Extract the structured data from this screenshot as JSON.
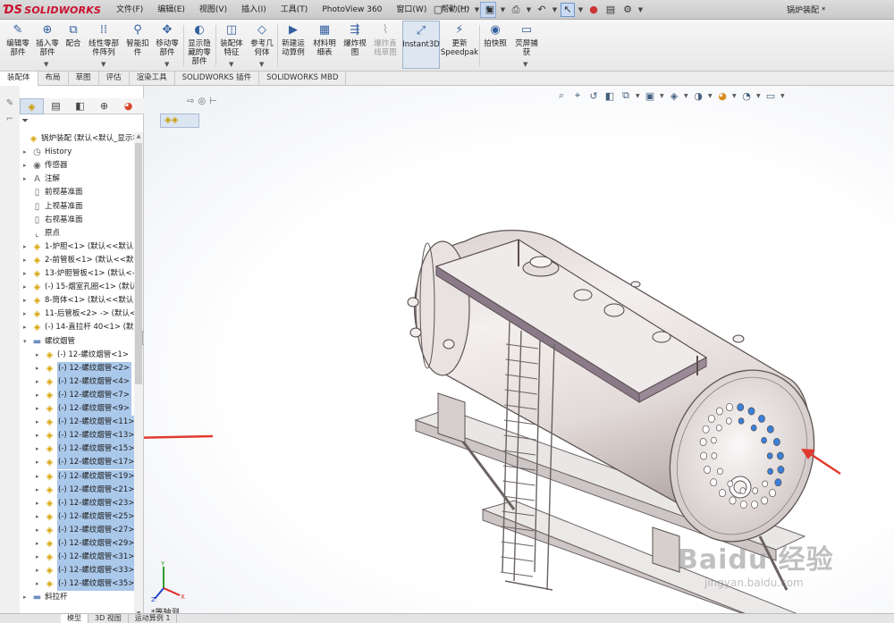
{
  "app": {
    "logo_text": "SOLIDWORKS",
    "doc_title": "锅炉装配 *"
  },
  "menu": [
    "文件(F)",
    "编辑(E)",
    "视图(V)",
    "插入(I)",
    "工具(T)",
    "PhotoView 360",
    "窗口(W)",
    "帮助(H)"
  ],
  "ribbon": {
    "buttons": [
      {
        "label": "编辑零\n部件",
        "icon": "edit-component-icon"
      },
      {
        "label": "插入零\n部件",
        "icon": "insert-component-icon"
      },
      {
        "label": "配合",
        "icon": "mate-icon"
      },
      {
        "label": "线性零部\n件阵列",
        "icon": "linear-pattern-icon"
      },
      {
        "label": "智能扣\n件",
        "icon": "smart-fastener-icon"
      },
      {
        "label": "移动零\n部件",
        "icon": "move-component-icon"
      },
      {
        "label": "显示隐\n藏的零\n部件",
        "icon": "show-hidden-icon"
      },
      {
        "label": "装配体\n特征",
        "icon": "assembly-feature-icon"
      },
      {
        "label": "参考几\n何体",
        "icon": "reference-geometry-icon"
      },
      {
        "label": "新建运\n动算例",
        "icon": "motion-study-icon"
      },
      {
        "label": "材料明\n细表",
        "icon": "bom-icon"
      },
      {
        "label": "爆炸视\n图",
        "icon": "exploded-view-icon"
      },
      {
        "label": "爆炸直\n线草图",
        "icon": "explode-line-sketch-icon",
        "disabled": true
      },
      {
        "label": "Instant3D",
        "icon": "instant3d-icon",
        "selected": true
      },
      {
        "label": "更新\nSpeedpak",
        "icon": "speedpak-icon"
      },
      {
        "label": "拍快照",
        "icon": "snapshot-icon"
      },
      {
        "label": "荧屏捕\n获",
        "icon": "screen-capture-icon"
      }
    ]
  },
  "cm_tabs": [
    "装配体",
    "布局",
    "草图",
    "评估",
    "渲染工具",
    "SOLIDWORKS 插件",
    "SOLIDWORKS MBD"
  ],
  "tree": {
    "root": "锅炉装配 (默认<默认_显示状",
    "items": [
      {
        "label": "History",
        "icon": "history-icon"
      },
      {
        "label": "传感器",
        "icon": "sensor-icon"
      },
      {
        "label": "注解",
        "icon": "annotation-icon"
      },
      {
        "label": "前视基准面",
        "icon": "plane-icon"
      },
      {
        "label": "上视基准面",
        "icon": "plane-icon"
      },
      {
        "label": "右视基准面",
        "icon": "plane-icon"
      },
      {
        "label": "原点",
        "icon": "origin-icon"
      },
      {
        "label": "1-炉胆<1> (默认<<默认",
        "icon": "part-icon"
      },
      {
        "label": "2-前管板<1> (默认<<默认",
        "icon": "part-icon"
      },
      {
        "label": "13-炉胆管板<1> (默认<-",
        "icon": "part-icon"
      },
      {
        "label": "(-) 15-烟室孔圈<1> (默认",
        "icon": "part-icon"
      },
      {
        "label": "8-筒体<1> (默认<<默认",
        "icon": "part-icon"
      },
      {
        "label": "11-后管板<2> -> (默认<",
        "icon": "part-icon"
      },
      {
        "label": "(-) 14-直拉杆 40<1> (默",
        "icon": "part-icon"
      },
      {
        "label": "螺纹烟管",
        "icon": "folder-icon"
      },
      {
        "label": "(-) 12-螺纹烟管<1>",
        "icon": "part-icon"
      },
      {
        "label": "(-) 12-螺纹烟管<2>",
        "icon": "part-icon"
      },
      {
        "label": "(-) 12-螺纹烟管<4>",
        "icon": "part-icon"
      },
      {
        "label": "(-) 12-螺纹烟管<7>",
        "icon": "part-icon"
      },
      {
        "label": "(-) 12-螺纹烟管<9>",
        "icon": "part-icon"
      },
      {
        "label": "(-) 12-螺纹烟管<11>",
        "icon": "part-icon"
      },
      {
        "label": "(-) 12-螺纹烟管<13>",
        "icon": "part-icon"
      },
      {
        "label": "(-) 12-螺纹烟管<15>",
        "icon": "part-icon"
      },
      {
        "label": "(-) 12-螺纹烟管<17>",
        "icon": "part-icon"
      },
      {
        "label": "(-) 12-螺纹烟管<19>",
        "icon": "part-icon"
      },
      {
        "label": "(-) 12-螺纹烟管<21>",
        "icon": "part-icon"
      },
      {
        "label": "(-) 12-螺纹烟管<23>",
        "icon": "part-icon"
      },
      {
        "label": "(-) 12-螺纹烟管<25>",
        "icon": "part-icon"
      },
      {
        "label": "(-) 12-螺纹烟管<27>",
        "icon": "part-icon"
      },
      {
        "label": "(-) 12-螺纹烟管<29>",
        "icon": "part-icon"
      },
      {
        "label": "(-) 12-螺纹烟管<31>",
        "icon": "part-icon"
      },
      {
        "label": "(-) 12-螺纹烟管<33>",
        "icon": "part-icon"
      },
      {
        "label": "(-) 12-螺纹烟管<35>",
        "icon": "part-icon"
      },
      {
        "label": "斜拉杆",
        "icon": "folder-icon"
      }
    ]
  },
  "view": {
    "name": "*等轴测",
    "triad_labels": [
      "Y",
      "X",
      "Z"
    ]
  },
  "watermark": {
    "main": "Baidu 经验",
    "sub": "jingyan.baidu.com"
  },
  "bottom_tabs": [
    "模型",
    "3D 视图",
    "运动算例 1"
  ],
  "colors": {
    "accent": "#c8102e",
    "selection": "#aac8ea",
    "arrow": "#e03a2e",
    "tube_highlight": "#3a7fd8"
  }
}
